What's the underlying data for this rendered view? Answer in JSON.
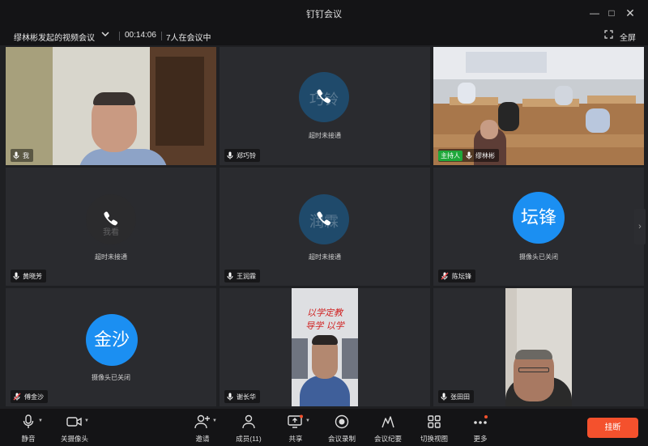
{
  "window": {
    "title": "钉钉会议"
  },
  "info": {
    "meeting_name": "缪林彬发起的视频会议",
    "duration": "00:14:06",
    "participants": "7人在会议中",
    "fullscreen_label": "全屏"
  },
  "tiles": [
    {
      "name": "我",
      "status": ""
    },
    {
      "name": "郑巧铃",
      "status": "超时未接通",
      "ghost": "巧铃"
    },
    {
      "name": "缪林彬",
      "status": "",
      "badge": "主持人"
    },
    {
      "name": "黄晓芳",
      "status": "超时未接通",
      "ghost": "我看"
    },
    {
      "name": "王润霖",
      "status": "超时未接通",
      "ghost": "润霖"
    },
    {
      "name": "陈坛锋",
      "status": "摄像头已关闭",
      "avatar": "坛锋"
    },
    {
      "name": "傅金沙",
      "status": "摄像头已关闭",
      "avatar": "金沙"
    },
    {
      "name": "谢长华",
      "status": "",
      "banner1": "以学定教",
      "banner2": "导学 以学"
    },
    {
      "name": "张田田",
      "status": ""
    }
  ],
  "toolbar": {
    "mute": "静音",
    "camera": "关摄像头",
    "invite": "邀请",
    "members": "成员(11)",
    "share": "共享",
    "record": "会议录制",
    "minutes": "会议纪要",
    "switch_view": "切换视图",
    "more": "更多",
    "hangup": "挂断"
  },
  "colors": {
    "hangup": "#f4512d",
    "avatar": "#1b8ff2",
    "host_badge": "#1fa83a"
  }
}
